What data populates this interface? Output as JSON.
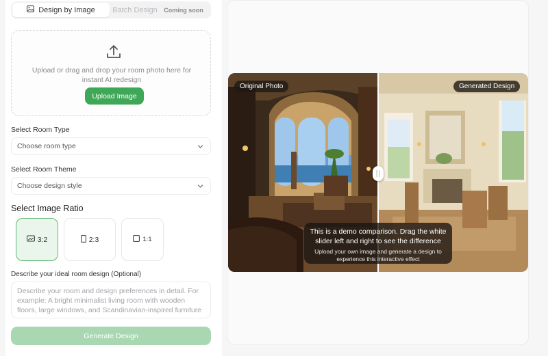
{
  "tabs": {
    "design_by_image": "Design by Image",
    "batch_design": "Batch Design",
    "coming_soon": "Coming soon"
  },
  "upload": {
    "instructions": "Upload or drag and drop your room photo here for instant AI redesign",
    "button": "Upload Image"
  },
  "room_type": {
    "label": "Select Room Type",
    "value": "Choose room type"
  },
  "room_theme": {
    "label": "Select Room Theme",
    "value": "Choose design style"
  },
  "ratio": {
    "title": "Select Image Ratio",
    "options": [
      "3:2",
      "2:3",
      "1:1"
    ],
    "selected": "3:2"
  },
  "description": {
    "label": "Describe your ideal room design (Optional)",
    "placeholder": "Describe your room and design preferences in detail. For example: A bright minimalist living room with wooden floors, large windows, and Scandinavian-inspired furniture"
  },
  "generate": {
    "button": "Generate Design"
  },
  "comparison": {
    "original_label": "Original Photo",
    "generated_label": "Generated Design",
    "demo_text": "This is a demo comparison. Drag the white slider left and right to see the difference",
    "demo_subtext": "Upload your own image and generate a design to experience this interactive effect"
  },
  "colors": {
    "accent": "#3fa858",
    "accent_disabled": "#a8d7b2",
    "selected_bg": "#eaf6ec"
  },
  "icons": [
    "image-icon",
    "upload-icon",
    "chevron-down-icon",
    "landscape-ratio-icon",
    "portrait-ratio-icon",
    "square-ratio-icon"
  ]
}
